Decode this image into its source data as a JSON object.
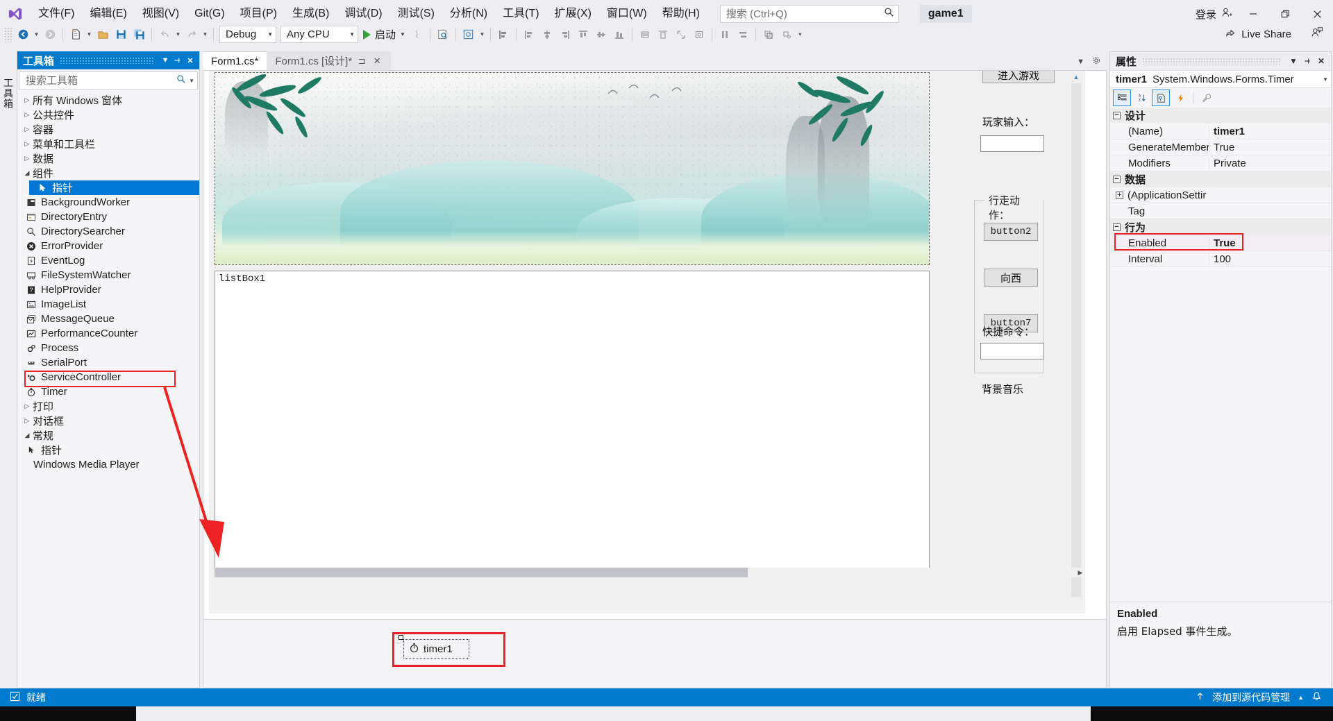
{
  "app": {
    "project_name": "game1",
    "logo_icon": "visual-studio-logo"
  },
  "menubar": {
    "items": [
      {
        "label": "文件(F)",
        "name": "file"
      },
      {
        "label": "编辑(E)",
        "name": "edit"
      },
      {
        "label": "视图(V)",
        "name": "view"
      },
      {
        "label": "Git(G)",
        "name": "git"
      },
      {
        "label": "项目(P)",
        "name": "project"
      },
      {
        "label": "生成(B)",
        "name": "build"
      },
      {
        "label": "调试(D)",
        "name": "debug"
      },
      {
        "label": "测试(S)",
        "name": "test"
      },
      {
        "label": "分析(N)",
        "name": "analyze"
      },
      {
        "label": "工具(T)",
        "name": "tools"
      },
      {
        "label": "扩展(X)",
        "name": "extensions"
      },
      {
        "label": "窗口(W)",
        "name": "window"
      },
      {
        "label": "帮助(H)",
        "name": "help"
      }
    ]
  },
  "search": {
    "placeholder": "搜索 (Ctrl+Q)",
    "value": "",
    "icon": "search-icon"
  },
  "titlebar": {
    "signin_label": "登录",
    "signin_icon": "account-add-icon",
    "minimize_icon": "minimize-icon",
    "restore_icon": "restore-icon",
    "close_icon": "close-icon"
  },
  "liveshare": {
    "label": "Live Share",
    "icon": "live-share-icon",
    "secondary_icon": "live-share-feedback-icon"
  },
  "toolbar": {
    "configuration": "Debug",
    "platform": "Any CPU",
    "run_label": "启动",
    "icons": [
      "navigate-back-icon",
      "navigate-forward-icon",
      "new-item-icon",
      "open-file-icon",
      "save-icon",
      "save-all-icon",
      "undo-icon",
      "redo-icon",
      "hot-reload-icon",
      "find-icon",
      "preview-icon",
      "align-lefts-icon",
      "align-centers-icon",
      "align-rights-icon",
      "align-tops-icon",
      "align-middles-icon",
      "align-bottoms-icon",
      "make-same-width-icon",
      "make-same-height-icon",
      "make-same-size-icon",
      "size-to-grid-icon",
      "horizontal-spacing-icon",
      "vertical-spacing-icon",
      "bring-to-front-icon",
      "send-to-back-icon"
    ]
  },
  "vertical_tab": {
    "label": "工具箱"
  },
  "toolbox": {
    "title": "工具箱",
    "search_placeholder": "搜索工具箱",
    "search_value": "",
    "dropdown_icon": "chevron-down-icon",
    "pin_icon": "pin-icon",
    "close_icon": "close-icon",
    "rows": [
      {
        "label": "所有 Windows 窗体",
        "kind": "group",
        "expanded": false,
        "icon": "triangle-right-icon"
      },
      {
        "label": "公共控件",
        "kind": "group",
        "expanded": false,
        "icon": "triangle-right-icon"
      },
      {
        "label": "容器",
        "kind": "group",
        "expanded": false,
        "icon": "triangle-right-icon"
      },
      {
        "label": "菜单和工具栏",
        "kind": "group",
        "expanded": false,
        "icon": "triangle-right-icon"
      },
      {
        "label": "数据",
        "kind": "group",
        "expanded": false,
        "icon": "triangle-right-icon"
      },
      {
        "label": "组件",
        "kind": "group",
        "expanded": true,
        "icon": "triangle-down-icon"
      },
      {
        "label": "指针",
        "kind": "item",
        "selected": true,
        "icon": "pointer-icon"
      },
      {
        "label": "BackgroundWorker",
        "kind": "item",
        "icon": "background-worker-icon"
      },
      {
        "label": "DirectoryEntry",
        "kind": "item",
        "icon": "directory-entry-icon"
      },
      {
        "label": "DirectorySearcher",
        "kind": "item",
        "icon": "directory-searcher-icon"
      },
      {
        "label": "ErrorProvider",
        "kind": "item",
        "icon": "error-provider-icon"
      },
      {
        "label": "EventLog",
        "kind": "item",
        "icon": "event-log-icon"
      },
      {
        "label": "FileSystemWatcher",
        "kind": "item",
        "icon": "file-system-watcher-icon"
      },
      {
        "label": "HelpProvider",
        "kind": "item",
        "icon": "help-provider-icon"
      },
      {
        "label": "ImageList",
        "kind": "item",
        "icon": "image-list-icon"
      },
      {
        "label": "MessageQueue",
        "kind": "item",
        "icon": "message-queue-icon"
      },
      {
        "label": "PerformanceCounter",
        "kind": "item",
        "icon": "performance-counter-icon"
      },
      {
        "label": "Process",
        "kind": "item",
        "icon": "process-icon"
      },
      {
        "label": "SerialPort",
        "kind": "item",
        "icon": "serial-port-icon"
      },
      {
        "label": "ServiceController",
        "kind": "item",
        "icon": "service-controller-icon"
      },
      {
        "label": "Timer",
        "kind": "item",
        "icon": "timer-icon",
        "highlighted": true
      },
      {
        "label": "打印",
        "kind": "group",
        "expanded": false,
        "icon": "triangle-right-icon"
      },
      {
        "label": "对话框",
        "kind": "group",
        "expanded": false,
        "icon": "triangle-right-icon"
      },
      {
        "label": "常规",
        "kind": "group",
        "expanded": true,
        "icon": "triangle-down-icon"
      },
      {
        "label": "指针",
        "kind": "item",
        "icon": "pointer-icon"
      },
      {
        "label": "Windows Media Player",
        "kind": "item",
        "icon": "blank-icon"
      }
    ]
  },
  "document_tabs": {
    "tabs": [
      {
        "label": "Form1.cs*",
        "active": true,
        "name": "form1-cs"
      },
      {
        "label": "Form1.cs [设计]*",
        "active": false,
        "name": "form1-designer",
        "pin_icon": "pin-icon",
        "close_icon": "close-icon"
      }
    ],
    "dropdown_icon": "chevron-down-icon",
    "settings_icon": "gear-icon"
  },
  "designer": {
    "listbox_label": "listBox1",
    "enter_game_button": "进入游戏",
    "player_input_label": "玩家输入：",
    "player_input_value": "",
    "walk_group_title": "行走动作：",
    "walk_buttons": [
      "button2",
      "向西",
      "button7"
    ],
    "quick_command_label": "快捷命令：",
    "quick_command_value": "",
    "bgm_label": "背景音乐",
    "tray_component": "timer1",
    "tray_icon": "timer-icon",
    "scroll_left_icon": "triangle-left-icon",
    "scroll_right_icon": "triangle-right-icon",
    "scroll_up_icon": "triangle-up-icon"
  },
  "properties": {
    "title": "属性",
    "dropdown_icon": "chevron-down-icon",
    "pin_icon": "pin-icon",
    "close_icon": "close-icon",
    "object_name": "timer1",
    "object_type": "System.Windows.Forms.Timer",
    "toolbar_icons": [
      {
        "name": "categorized-icon",
        "active": true
      },
      {
        "name": "alphabetical-sort-icon",
        "active": false
      },
      {
        "name": "properties-page-icon",
        "active": true
      },
      {
        "name": "events-lightning-icon",
        "active": false
      },
      {
        "name": "property-pages-wrench-icon",
        "active": false
      }
    ],
    "categories": [
      {
        "name": "设计",
        "expanded": true,
        "rows": [
          {
            "key": "(Name)",
            "value": "timer1",
            "bold": true
          },
          {
            "key": "GenerateMember",
            "value": "True"
          },
          {
            "key": "Modifiers",
            "value": "Private"
          }
        ]
      },
      {
        "name": "数据",
        "expanded": true,
        "rows": [
          {
            "key": "(ApplicationSettir",
            "value": "",
            "expandable": true
          },
          {
            "key": "Tag",
            "value": ""
          }
        ]
      },
      {
        "name": "行为",
        "expanded": true,
        "rows": [
          {
            "key": "Enabled",
            "value": "True",
            "bold": true,
            "highlighted": true
          },
          {
            "key": "Interval",
            "value": "100"
          }
        ]
      }
    ],
    "description_title": "Enabled",
    "description_text": "启用 Elapsed 事件生成。"
  },
  "statusbar": {
    "status_icon": "ready-check-icon",
    "status_text": "就绪",
    "source_control_icon": "arrow-up-icon",
    "source_control_text": "添加到源代码管理",
    "source_control_caret": "caret-up-icon",
    "notifications_icon": "bell-icon"
  },
  "colors": {
    "accent": "#007acc",
    "selection": "#0078d4",
    "highlight_box": "#ee2222",
    "chrome": "#eeeef2",
    "panel": "#f5f5f7"
  }
}
